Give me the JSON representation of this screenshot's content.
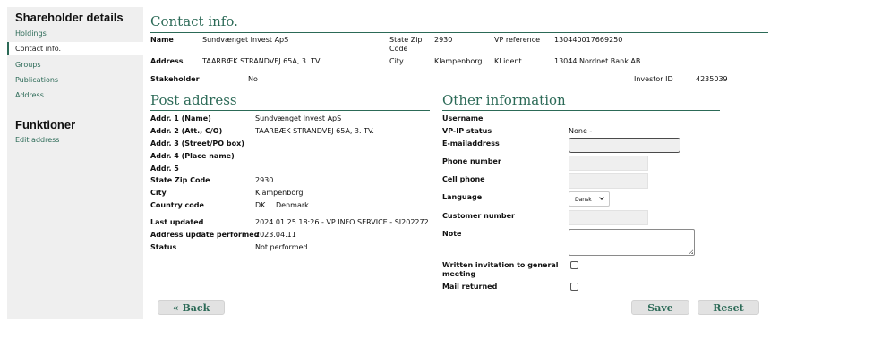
{
  "sidebar": {
    "title": "Shareholder details",
    "items": [
      {
        "label": "Holdings"
      },
      {
        "label": "Contact info."
      },
      {
        "label": "Groups"
      },
      {
        "label": "Publications"
      },
      {
        "label": "Address"
      }
    ],
    "functions_title": "Funktioner",
    "functions": [
      {
        "label": "Edit address"
      }
    ]
  },
  "contact": {
    "title": "Contact info.",
    "name_label": "Name",
    "name_value": "Sundvænget Invest ApS",
    "state_zip_label_1": "State Zip",
    "state_zip_label_2": "Code",
    "state_zip_value": "2930",
    "vp_reference_label": "VP reference",
    "vp_reference_value": "130440017669250",
    "address_label": "Address",
    "address_value": "TAARBÆK STRANDVEJ 65A, 3. TV.",
    "city_label": "City",
    "city_value": "Klampenborg",
    "ki_ident_label": "KI ident",
    "ki_ident_value": "13044 Nordnet Bank AB",
    "stakeholder_label": "Stakeholder",
    "stakeholder_value": "No",
    "investor_id_label": "Investor ID",
    "investor_id_value": "4235039"
  },
  "post_address": {
    "title": "Post address",
    "rows": [
      {
        "label": "Addr. 1 (Name)",
        "value": "Sundvænget Invest ApS"
      },
      {
        "label": "Addr. 2 (Att., C/O)",
        "value": "TAARBÆK STRANDVEJ 65A, 3. TV."
      },
      {
        "label": "Addr. 3 (Street/PO box)",
        "value": ""
      },
      {
        "label": "Addr. 4 (Place name)",
        "value": ""
      },
      {
        "label": "Addr. 5",
        "value": ""
      },
      {
        "label": "State Zip Code",
        "value": "2930"
      },
      {
        "label": "City",
        "value": "Klampenborg"
      }
    ],
    "country_label": "Country code",
    "country_code": "DK",
    "country_name": "Denmark",
    "last_updated_label": "Last updated",
    "last_updated_value": "2024.01.25 18:26  -  VP INFO SERVICE - SI202272",
    "address_update_label": "Address update performed",
    "address_update_value": "2023.04.11",
    "status_label": "Status",
    "status_value": "Not performed"
  },
  "other": {
    "title": "Other information",
    "username_label": "Username",
    "vpip_label": "VP-IP status",
    "vpip_value": "None -",
    "email_label": "E-mailaddress",
    "phone_label": "Phone number",
    "cell_label": "Cell phone",
    "language_label": "Language",
    "language_value": "Dansk",
    "customer_number_label": "Customer number",
    "note_label": "Note",
    "written_invitation_label_1": "Written invitation to general",
    "written_invitation_label_2": "meeting",
    "mail_returned_label": "Mail returned"
  },
  "buttons": {
    "back": "« Back",
    "save": "Save",
    "reset": "Reset"
  },
  "colors": {
    "accent": "#2c6a57",
    "sidebar_bg": "#efefef",
    "button_bg": "#e2e2e2"
  }
}
